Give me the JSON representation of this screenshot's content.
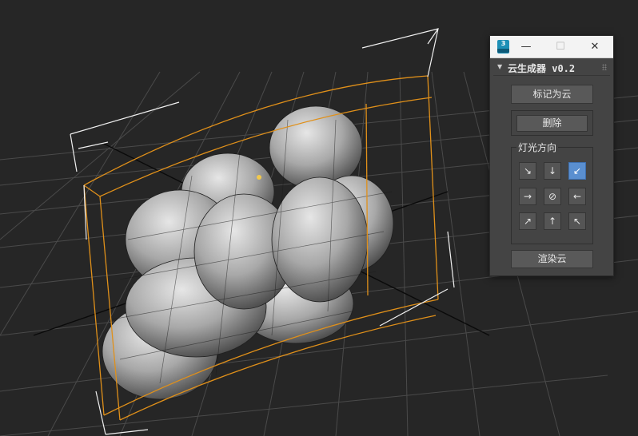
{
  "window": {
    "app_icon_text": "3",
    "minimize_glyph": "—",
    "maximize_glyph": "☐",
    "close_glyph": "✕"
  },
  "rollout": {
    "arrow": "▼",
    "title": "云生成器 v0.2"
  },
  "buttons": {
    "mark_as_cloud": "标记为云",
    "delete": "删除",
    "render_cloud": "渲染云"
  },
  "light_direction": {
    "label": "灯光方向",
    "grid": [
      [
        "↘",
        "↓",
        "↙"
      ],
      [
        "→",
        "⊘",
        "←"
      ],
      [
        "↗",
        "↑",
        "↖"
      ]
    ],
    "selected": "↙"
  },
  "colors": {
    "viewport_bg": "#262626",
    "grid": "#4a4a4a",
    "selection_bbox": "#e0901a",
    "gizmo": "#f0f0f0",
    "cloud_shade": "#9a9a9a",
    "active_button": "#5a8fd0"
  }
}
